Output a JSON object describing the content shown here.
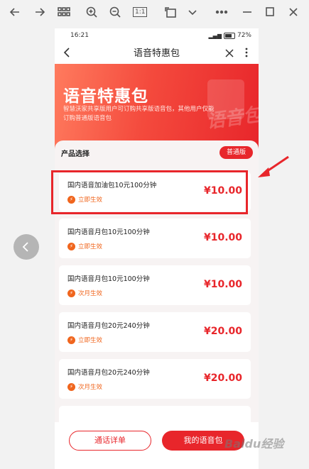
{
  "viewer": {
    "zoom_label": "1:1"
  },
  "status_bar": {
    "time": "16:21",
    "battery": "72%"
  },
  "page": {
    "title": "语音特惠包"
  },
  "hero": {
    "heading": "语音特惠包",
    "description": "智慧沃家共享版用户可订购共享版语音包，其他用户仅能订购普通版语音包",
    "watermark": "语音包"
  },
  "section": {
    "title": "产品选择",
    "version_label": "普通版"
  },
  "products": [
    {
      "name": "国内语音加油包10元100分钟",
      "effect": "立即生效",
      "price": "¥10.00"
    },
    {
      "name": "国内语音月包10元100分钟",
      "effect": "立即生效",
      "price": "¥10.00"
    },
    {
      "name": "国内语音月包10元100分钟",
      "effect": "次月生效",
      "price": "¥10.00"
    },
    {
      "name": "国内语音月包20元240分钟",
      "effect": "立即生效",
      "price": "¥20.00"
    },
    {
      "name": "国内语音月包20元240分钟",
      "effect": "次月生效",
      "price": "¥20.00"
    }
  ],
  "footer": {
    "left_button": "通话详单",
    "right_button": "我的语音包"
  },
  "colors": {
    "accent": "#e8262b",
    "effect_orange": "#f0651d"
  },
  "site_watermark": "Baidu经验"
}
